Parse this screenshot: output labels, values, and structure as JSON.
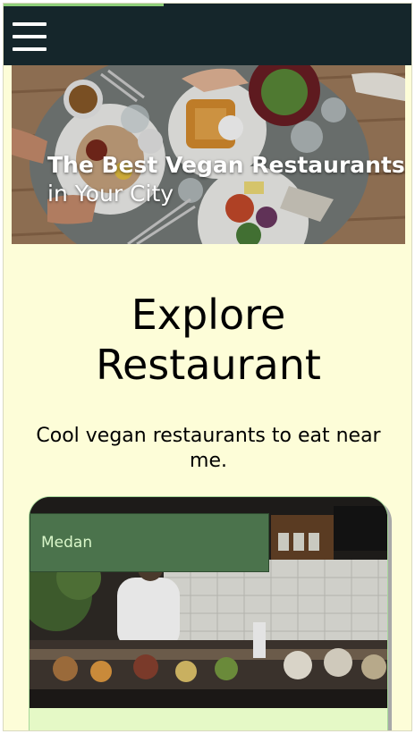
{
  "header": {
    "menu_icon": "hamburger-menu-icon",
    "progress": 0.39,
    "colors": {
      "bar": "#15262b",
      "progress": "#8fcf7a",
      "page_bg": "#fdfdd8"
    }
  },
  "hero": {
    "title": "The Best Vegan Restaurants",
    "subtitle": "in Your City"
  },
  "explore": {
    "title_line1": "Explore",
    "title_line2": "Restaurant",
    "description": "Cool vegan restaurants to eat near me."
  },
  "restaurants": [
    {
      "city": "Medan"
    }
  ]
}
